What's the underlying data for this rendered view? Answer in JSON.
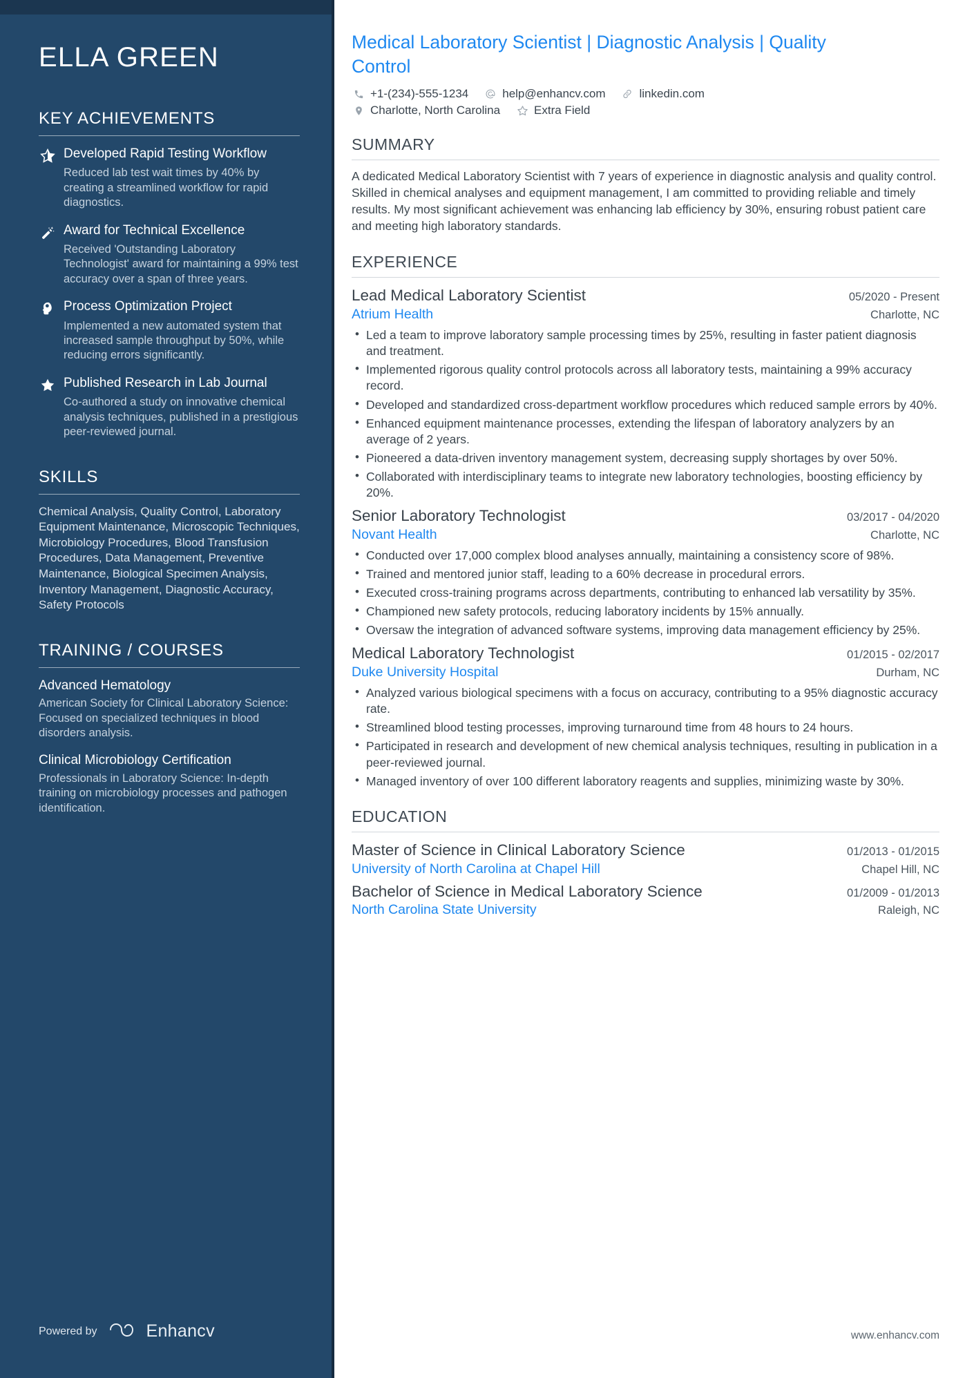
{
  "sidebar": {
    "name": "ELLA GREEN",
    "sections": {
      "key_achievements": {
        "heading": "KEY ACHIEVEMENTS",
        "items": [
          {
            "icon": "star-half-icon",
            "title": "Developed Rapid Testing Workflow",
            "description": "Reduced lab test wait times by 40% by creating a streamlined workflow for rapid diagnostics."
          },
          {
            "icon": "magic-wand-icon",
            "title": "Award for Technical Excellence",
            "description": "Received 'Outstanding Laboratory Technologist' award for maintaining a 99% test accuracy over a span of three years."
          },
          {
            "icon": "lightbulb-head-icon",
            "title": "Process Optimization Project",
            "description": "Implemented a new automated system that increased sample throughput by 50%, while reducing errors significantly."
          },
          {
            "icon": "star-filled-icon",
            "title": "Published Research in Lab Journal",
            "description": "Co-authored a study on innovative chemical analysis techniques, published in a prestigious peer-reviewed journal."
          }
        ]
      },
      "skills": {
        "heading": "SKILLS",
        "text": "Chemical Analysis, Quality Control, Laboratory Equipment Maintenance, Microscopic Techniques, Microbiology Procedures, Blood Transfusion Procedures, Data Management, Preventive Maintenance, Biological Specimen Analysis, Inventory Management, Diagnostic Accuracy, Safety Protocols"
      },
      "training": {
        "heading": "TRAINING / COURSES",
        "items": [
          {
            "title": "Advanced Hematology",
            "description": "American Society for Clinical Laboratory Science: Focused on specialized techniques in blood disorders analysis."
          },
          {
            "title": "Clinical Microbiology Certification",
            "description": "Professionals in Laboratory Science: In-depth training on microbiology processes and pathogen identification."
          }
        ]
      }
    },
    "footer": {
      "powered_by_label": "Powered by",
      "brand_name": "Enhancv"
    }
  },
  "main": {
    "headline": "Medical Laboratory Scientist | Diagnostic Analysis | Quality Control",
    "contact": {
      "row1": [
        {
          "icon": "phone-icon",
          "value": "+1-(234)-555-1234"
        },
        {
          "icon": "at-sign-icon",
          "value": "help@enhancv.com"
        },
        {
          "icon": "link-icon",
          "value": "linkedin.com"
        }
      ],
      "row2": [
        {
          "icon": "location-pin-icon",
          "value": "Charlotte, North Carolina"
        },
        {
          "icon": "star-outline-icon",
          "value": "Extra Field"
        }
      ]
    },
    "summary": {
      "heading": "SUMMARY",
      "text": "A dedicated Medical Laboratory Scientist with 7 years of experience in diagnostic analysis and quality control. Skilled in chemical analyses and equipment management, I am committed to providing reliable and timely results. My most significant achievement was enhancing lab efficiency by 30%, ensuring robust patient care and meeting high laboratory standards."
    },
    "experience": {
      "heading": "EXPERIENCE",
      "entries": [
        {
          "title": "Lead Medical Laboratory Scientist",
          "date": "05/2020 - Present",
          "organization": "Atrium Health",
          "location": "Charlotte, NC",
          "bullets": [
            "Led a team to improve laboratory sample processing times by 25%, resulting in faster patient diagnosis and treatment.",
            "Implemented rigorous quality control protocols across all laboratory tests, maintaining a 99% accuracy record.",
            "Developed and standardized cross-department workflow procedures which reduced sample errors by 40%.",
            "Enhanced equipment maintenance processes, extending the lifespan of laboratory analyzers by an average of 2 years.",
            "Pioneered a data-driven inventory management system, decreasing supply shortages by over 50%.",
            "Collaborated with interdisciplinary teams to integrate new laboratory technologies, boosting efficiency by 20%."
          ]
        },
        {
          "title": "Senior Laboratory Technologist",
          "date": "03/2017 - 04/2020",
          "organization": "Novant Health",
          "location": "Charlotte, NC",
          "bullets": [
            "Conducted over 17,000 complex blood analyses annually, maintaining a consistency score of 98%.",
            "Trained and mentored junior staff, leading to a 60% decrease in procedural errors.",
            "Executed cross-training programs across departments, contributing to enhanced lab versatility by 35%.",
            "Championed new safety protocols, reducing laboratory incidents by 15% annually.",
            "Oversaw the integration of advanced software systems, improving data management efficiency by 25%."
          ]
        },
        {
          "title": "Medical Laboratory Technologist",
          "date": "01/2015 - 02/2017",
          "organization": "Duke University Hospital",
          "location": "Durham, NC",
          "bullets": [
            "Analyzed various biological specimens with a focus on accuracy, contributing to a 95% diagnostic accuracy rate.",
            "Streamlined blood testing processes, improving turnaround time from 48 hours to 24 hours.",
            "Participated in research and development of new chemical analysis techniques, resulting in publication in a peer-reviewed journal.",
            "Managed inventory of over 100 different laboratory reagents and supplies, minimizing waste by 30%."
          ]
        }
      ]
    },
    "education": {
      "heading": "EDUCATION",
      "entries": [
        {
          "title": "Master of Science in Clinical Laboratory Science",
          "date": "01/2013 - 01/2015",
          "organization": "University of North Carolina at Chapel Hill",
          "location": "Chapel Hill, NC"
        },
        {
          "title": "Bachelor of Science in Medical Laboratory Science",
          "date": "01/2009 - 01/2013",
          "organization": "North Carolina State University",
          "location": "Raleigh, NC"
        }
      ]
    },
    "footer_url": "www.enhancv.com"
  },
  "colors": {
    "sidebar_bg": "#23486a",
    "accent_blue": "#1e88f0",
    "body_text": "#3d474f"
  }
}
